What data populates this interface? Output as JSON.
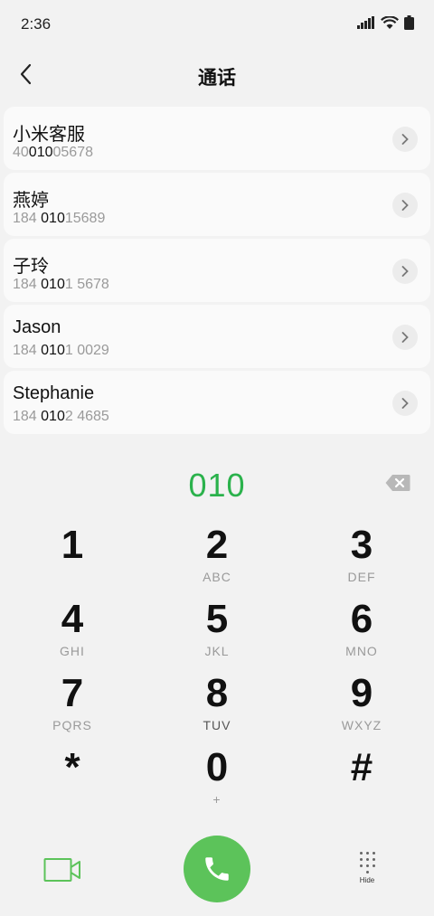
{
  "status": {
    "time": "2:36"
  },
  "header": {
    "title": "通话"
  },
  "contacts": [
    {
      "name": "小米客服",
      "num_pre": "40",
      "num_match": "010",
      "num_post": "05678"
    },
    {
      "name": "燕婷",
      "num_pre": "184 ",
      "num_match": "010",
      "num_post": "15689"
    },
    {
      "name": "子玲",
      "num_pre": "184 ",
      "num_match": "010",
      "num_post": "1 5678"
    },
    {
      "name": "Jason",
      "num_pre": "184 ",
      "num_match": "010",
      "num_post": "1 0029"
    },
    {
      "name": "Stephanie",
      "num_pre": "184 ",
      "num_match": "010",
      "num_post": "2 4685"
    }
  ],
  "input": {
    "value": "010"
  },
  "keys": [
    {
      "digit": "1",
      "letters": ""
    },
    {
      "digit": "2",
      "letters": "ABC"
    },
    {
      "digit": "3",
      "letters": "DEF"
    },
    {
      "digit": "4",
      "letters": "GHI"
    },
    {
      "digit": "5",
      "letters": "JKL"
    },
    {
      "digit": "6",
      "letters": "MNO"
    },
    {
      "digit": "7",
      "letters": "PQRS"
    },
    {
      "digit": "8",
      "letters": "TUV"
    },
    {
      "digit": "9",
      "letters": "WXYZ"
    },
    {
      "digit": "*",
      "letters": ""
    },
    {
      "digit": "0",
      "letters": "+"
    },
    {
      "digit": "#",
      "letters": ""
    }
  ],
  "bottom": {
    "hide_label": "Hide"
  },
  "colors": {
    "accent_green": "#2bb24c",
    "call_button": "#5cc35a"
  }
}
